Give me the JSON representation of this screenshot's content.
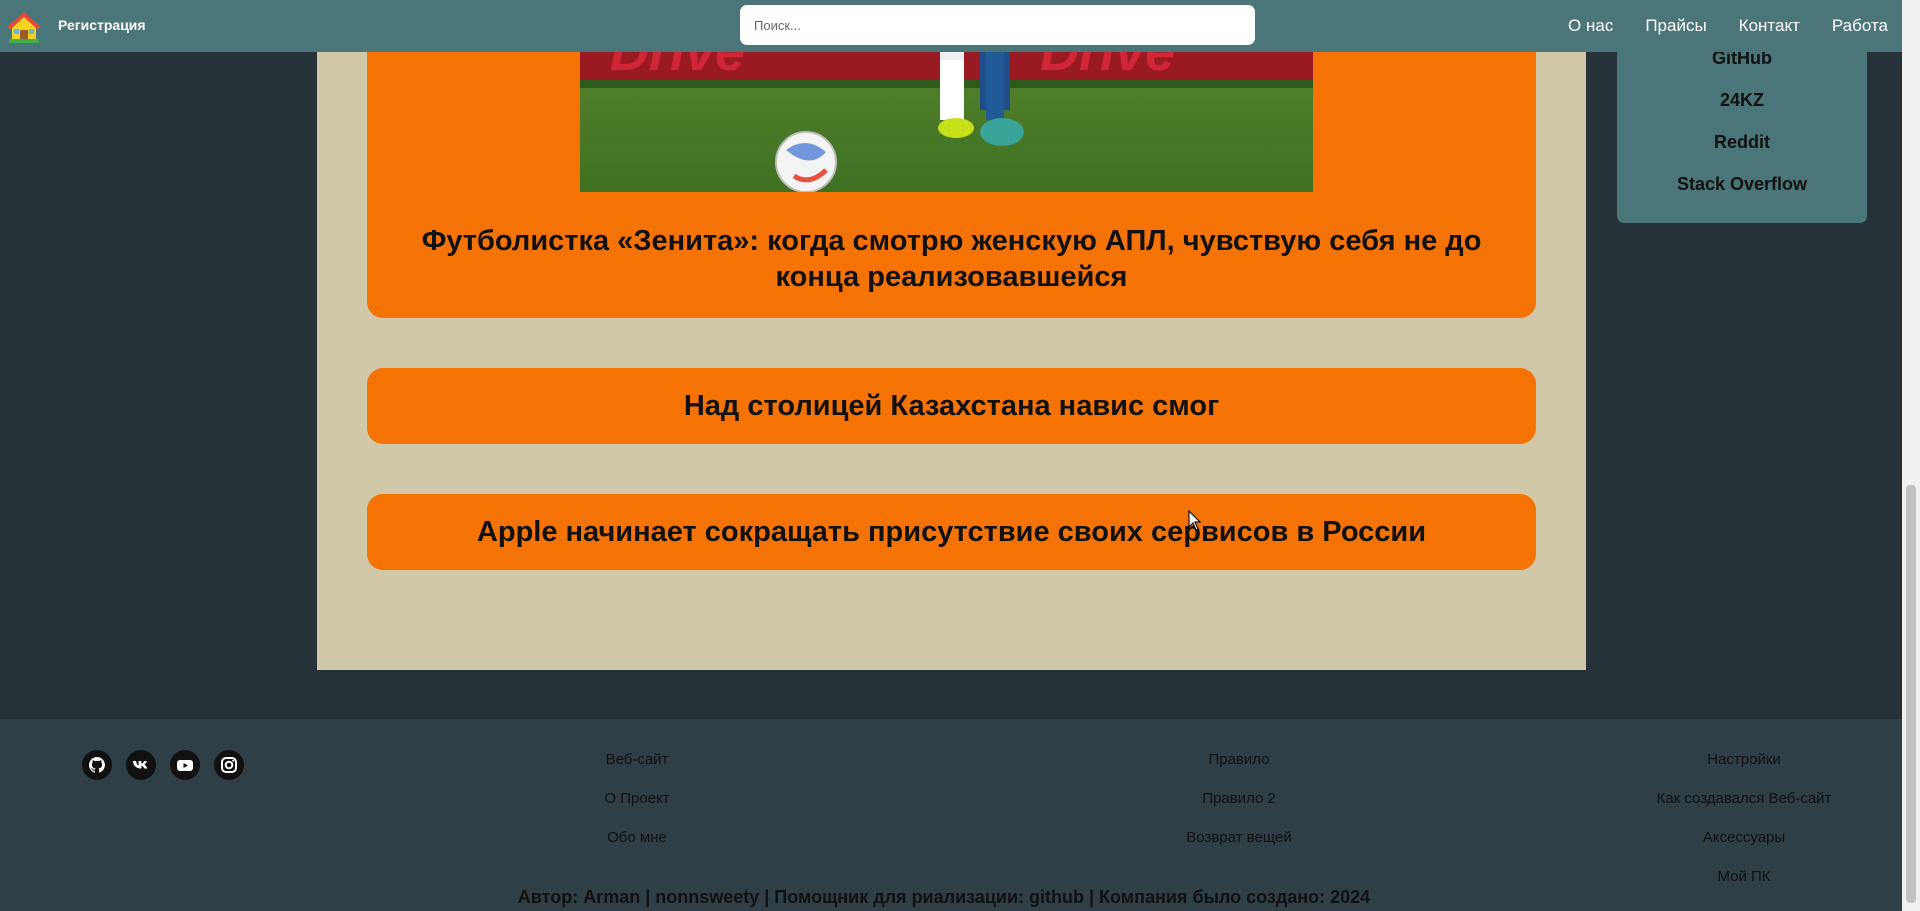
{
  "header": {
    "home_icon": "house-icon",
    "register_label": "Регистрация",
    "search_placeholder": "Поиск...",
    "nav": [
      "О нас",
      "Прайсы",
      "Контакт",
      "Работа"
    ]
  },
  "articles": [
    {
      "title": "Футболистка «Зенита»: когда смотрю женскую АПЛ, чувствую себя не до конца реализовавшейся",
      "image": "football-player-photo"
    },
    {
      "title": "Над столицей Казахстана навис смог"
    },
    {
      "title": "Apple начинает сокращать присутствие своих сервисов в России"
    }
  ],
  "sidebar": {
    "links": [
      "GitHub",
      "24KZ",
      "Reddit",
      "Stack Overflow"
    ]
  },
  "footer": {
    "social_icons": [
      "github-icon",
      "vk-icon",
      "youtube-icon",
      "instagram-icon"
    ],
    "col1": [
      "Веб-сайт",
      "О Проект",
      "Обо мне"
    ],
    "col2": [
      "Правило",
      "Правило 2",
      "Возврат вещей"
    ],
    "col3": [
      "Настройки",
      "Как создавался Веб-сайт",
      "Аксессуары",
      "Мой ПК"
    ],
    "credits": "Автор: Arman | nonnsweety | Помощник для риализации: github | Компания было создано: 2024"
  },
  "colors": {
    "header": "#4a7579",
    "background": "#263238",
    "content": "#d1c8a9",
    "card": "#f47304",
    "footer": "#2f3f45"
  }
}
